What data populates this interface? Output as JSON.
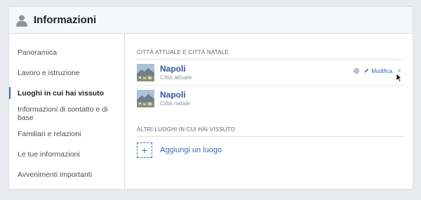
{
  "header": {
    "title": "Informazioni",
    "icon": "user-icon"
  },
  "sidebar": {
    "items": [
      {
        "label": "Panoramica",
        "active": false
      },
      {
        "label": "Lavoro e istruzione",
        "active": false
      },
      {
        "label": "Luoghi in cui hai vissuto",
        "active": true
      },
      {
        "label": "Informazioni di contatto e di base",
        "active": false
      },
      {
        "label": "Familiari e relazioni",
        "active": false
      },
      {
        "label": "Le tue informazioni",
        "active": false
      },
      {
        "label": "Avvenimenti importanti",
        "active": false
      }
    ]
  },
  "main": {
    "current_section": {
      "heading": "CITTÀ ATTUALE E CITTÀ NATALE",
      "places": [
        {
          "name": "Napoli",
          "subtitle": "Città attuale"
        },
        {
          "name": "Napoli",
          "subtitle": "Città natale"
        }
      ],
      "edit_label": "Modifica",
      "close_label": "×"
    },
    "other_section": {
      "heading": "ALTRI LUOGHI IN CUI HAI VISSUTO",
      "add_label": "Aggiungi un luogo",
      "add_symbol": "+"
    }
  },
  "colors": {
    "accent": "#4267b2",
    "link": "#365899",
    "background": "#e9ebee"
  }
}
